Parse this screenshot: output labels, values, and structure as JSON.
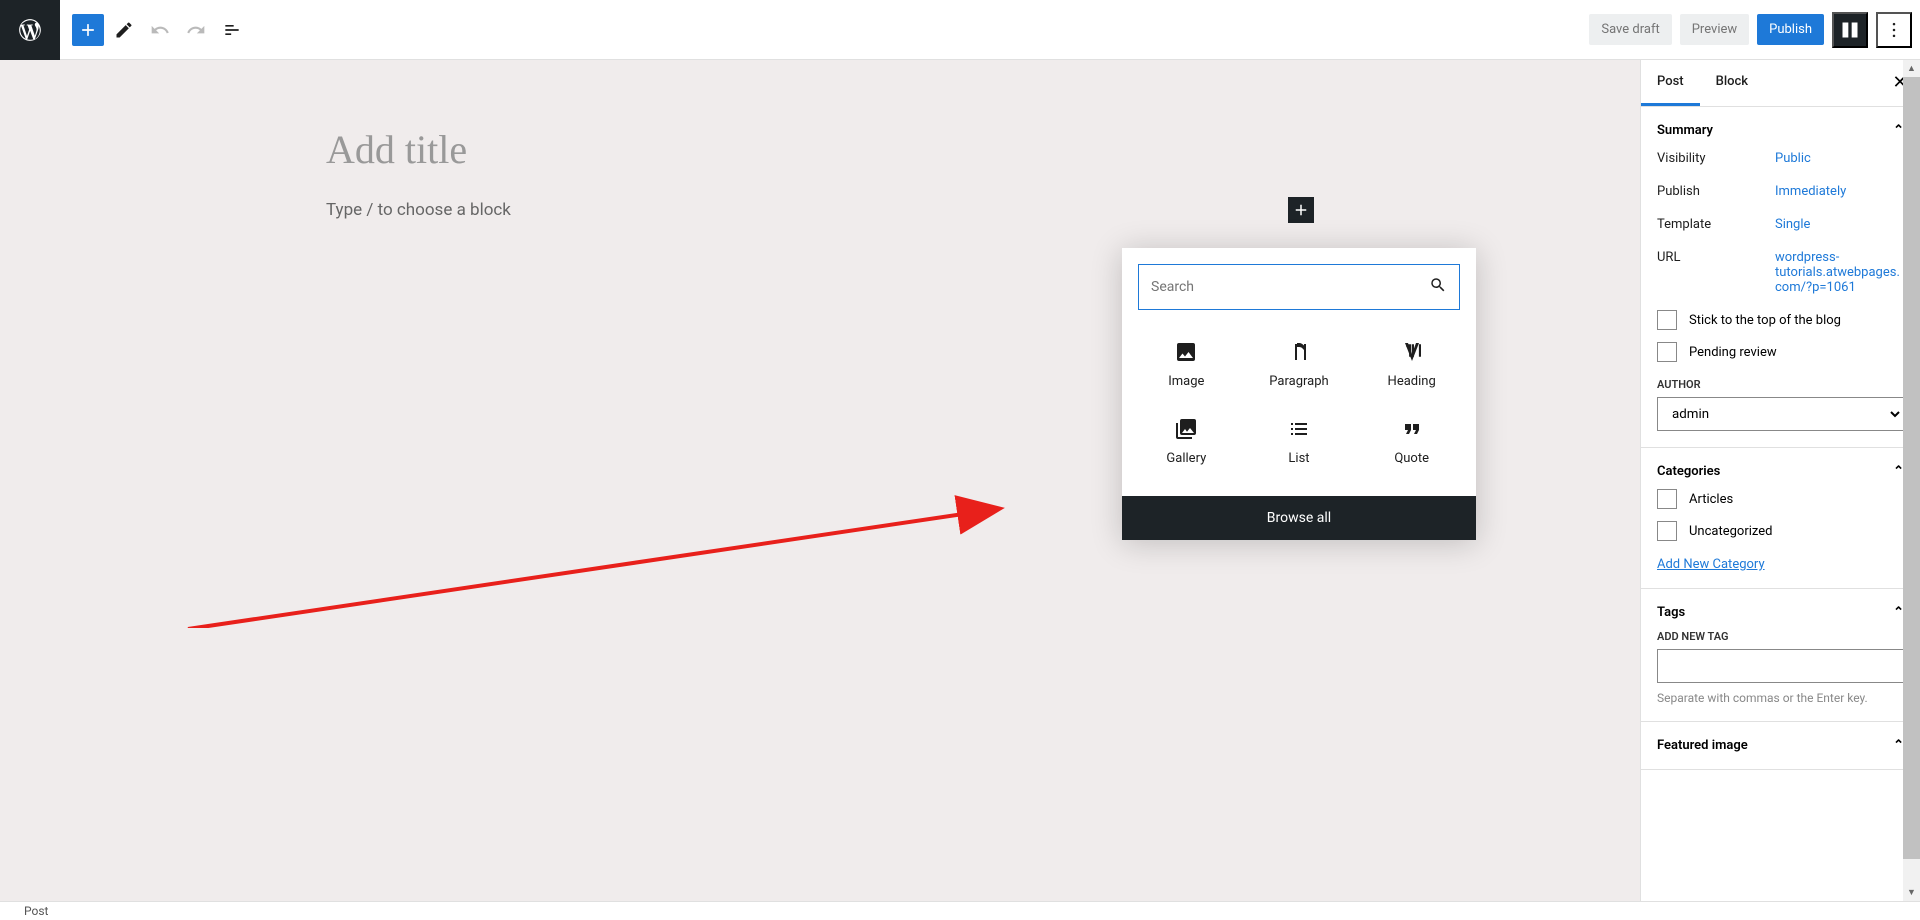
{
  "topbar": {
    "save_draft": "Save draft",
    "preview": "Preview",
    "publish": "Publish"
  },
  "editor": {
    "title_placeholder": "Add title",
    "body_prompt": "Type / to choose a block"
  },
  "inserter": {
    "search_placeholder": "Search",
    "blocks": [
      {
        "name": "image",
        "label": "Image"
      },
      {
        "name": "paragraph",
        "label": "Paragraph"
      },
      {
        "name": "heading",
        "label": "Heading"
      },
      {
        "name": "gallery",
        "label": "Gallery"
      },
      {
        "name": "list",
        "label": "List"
      },
      {
        "name": "quote",
        "label": "Quote"
      }
    ],
    "browse_all": "Browse all"
  },
  "sidebar": {
    "tabs": {
      "post": "Post",
      "block": "Block"
    },
    "summary": {
      "title": "Summary",
      "visibility_label": "Visibility",
      "visibility_value": "Public",
      "publish_label": "Publish",
      "publish_value": "Immediately",
      "template_label": "Template",
      "template_value": "Single",
      "url_label": "URL",
      "url_value": "wordpress-tutorials.atwebpages.com/?p=1061",
      "stick_label": "Stick to the top of the blog",
      "pending_label": "Pending review",
      "author_label": "AUTHOR",
      "author_value": "admin"
    },
    "categories": {
      "title": "Categories",
      "items": [
        "Articles",
        "Uncategorized"
      ],
      "add_new": "Add New Category"
    },
    "tags": {
      "title": "Tags",
      "add_new_label": "ADD NEW TAG",
      "hint": "Separate with commas or the Enter key."
    },
    "featured_image": {
      "title": "Featured image"
    }
  },
  "bottombar": {
    "breadcrumb": "Post"
  }
}
